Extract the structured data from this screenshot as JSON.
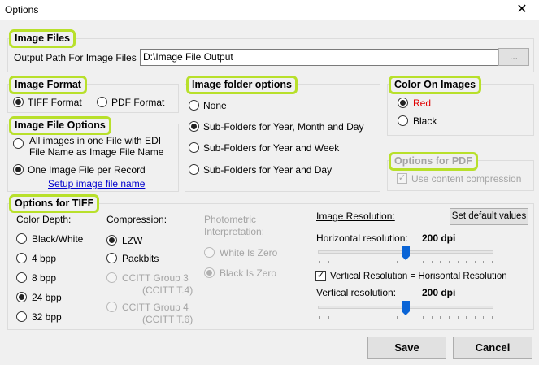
{
  "window": {
    "title": "Options",
    "close_glyph": "✕"
  },
  "image_files": {
    "heading": "Image Files",
    "output_path_label": "Output Path For Image Files",
    "output_path_value": "D:\\Image File Output",
    "browse_label": "..."
  },
  "image_format": {
    "heading": "Image Format",
    "tiff_label": "TIFF Format",
    "pdf_label": "PDF Format",
    "selected": "tiff"
  },
  "image_file_options": {
    "heading": "Image File Options",
    "all_in_one_line1": "All images in one File with EDI",
    "all_in_one_line2": "File Name as Image File Name",
    "one_per_record": "One Image File per Record",
    "setup_link": "Setup image file name",
    "selected": "one_per_record"
  },
  "folder_options": {
    "heading": "Image folder options",
    "none": "None",
    "year_month_day": "Sub-Folders for Year, Month and Day",
    "year_week": "Sub-Folders for Year and Week",
    "year_day": "Sub-Folders for Year and Day",
    "selected": "year_month_day"
  },
  "color_on_images": {
    "heading": "Color On Images",
    "red": "Red",
    "black": "Black",
    "selected": "red",
    "red_color": "#e00000"
  },
  "pdf_options": {
    "heading": "Options for PDF",
    "content_compression": "Use content compression",
    "checked": true,
    "enabled": false
  },
  "tiff_options": {
    "heading": "Options for TIFF",
    "color_depth_label": "Color Depth:",
    "color_depth": [
      "Black/White",
      "4 bpp",
      "8 bpp",
      "24 bpp",
      "32 bpp"
    ],
    "color_depth_selected": "24 bpp",
    "compression_label": "Compression:",
    "lzw": "LZW",
    "packbits": "Packbits",
    "ccitt3_line1": "CCITT Group 3",
    "ccitt3_line2": "(CCITT T.4)",
    "ccitt4_line1": "CCITT Group 4",
    "ccitt4_line2": "(CCITT T.6)",
    "compression_selected": "LZW",
    "photometric_line1": "Photometric",
    "photometric_line2": "Interpretation:",
    "white_is_zero": "White Is Zero",
    "black_is_zero": "Black Is Zero",
    "photometric_selected": "Black Is Zero",
    "resolution_label": "Image Resolution:",
    "set_default_label": "Set default values",
    "horizontal_label": "Horizontal resolution:",
    "horizontal_value": "200 dpi",
    "horizontal_slider_fraction": 0.5,
    "vertical_equals_label": "Vertical Resolution = Horisontal Resolution",
    "vertical_equals_checked": true,
    "vertical_label": "Vertical resolution:",
    "vertical_value": "200 dpi",
    "vertical_slider_fraction": 0.5
  },
  "footer": {
    "save_label": "Save",
    "cancel_label": "Cancel"
  },
  "icons": {
    "close": "close-icon",
    "check": "checkmark-icon",
    "check_glyph": "✓"
  },
  "colors": {
    "highlight": "#b8e02b",
    "slider": "#0a64d6",
    "link": "#0000cc"
  }
}
